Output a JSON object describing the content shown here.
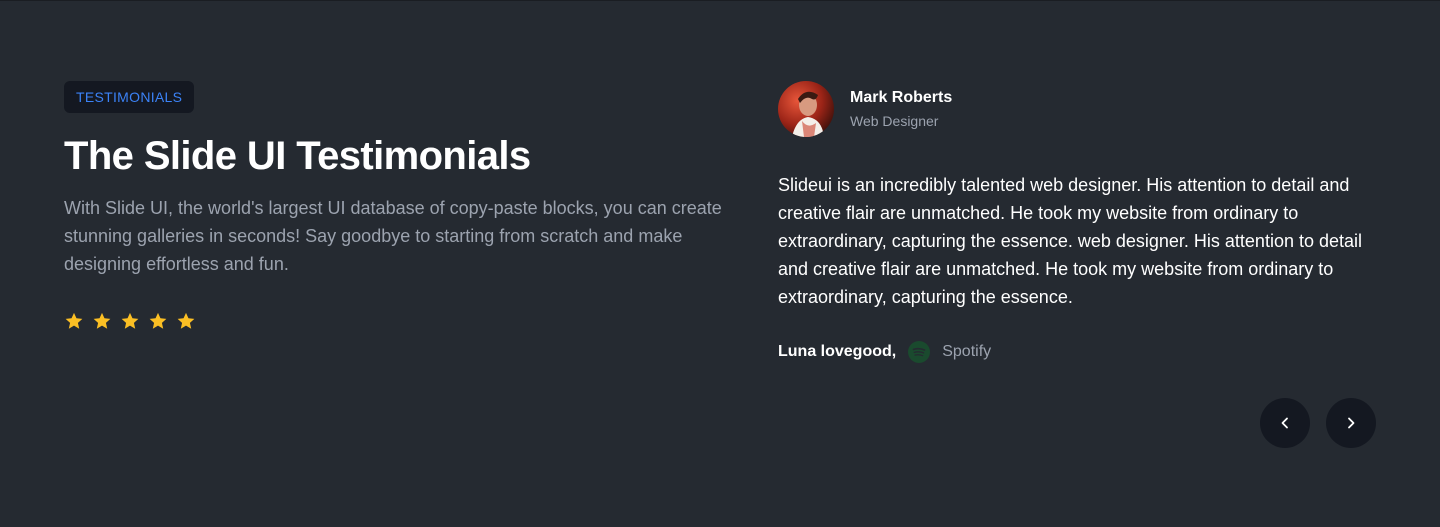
{
  "section": {
    "badge": "TESTIMONIALS",
    "title": "The Slide UI Testimonials",
    "description": "With Slide UI, the world's largest UI database of copy-paste blocks, you can create stunning galleries in seconds! Say goodbye to starting from scratch and make designing effortless and fun.",
    "rating": 5,
    "star_color": "#fbbf24"
  },
  "testimonial": {
    "author_name": "Mark Roberts",
    "author_role": "Web Designer",
    "quote": "Slideui is an incredibly talented web designer. His attention to detail and creative flair are unmatched. He took my website from ordinary to extraordinary, capturing the essence. web designer. His attention to detail and creative flair are unmatched. He took my website from ordinary to extraordinary, capturing the essence.",
    "source_name": "Luna lovegood,",
    "source_company": "Spotify",
    "source_icon": "spotify-logo-icon"
  },
  "navigation": {
    "prev_icon": "chevron-left-icon",
    "next_icon": "chevron-right-icon"
  },
  "colors": {
    "background": "#252a31",
    "accent": "#3b82f6",
    "button_bg": "#141821",
    "spotify_green": "#1db954"
  }
}
